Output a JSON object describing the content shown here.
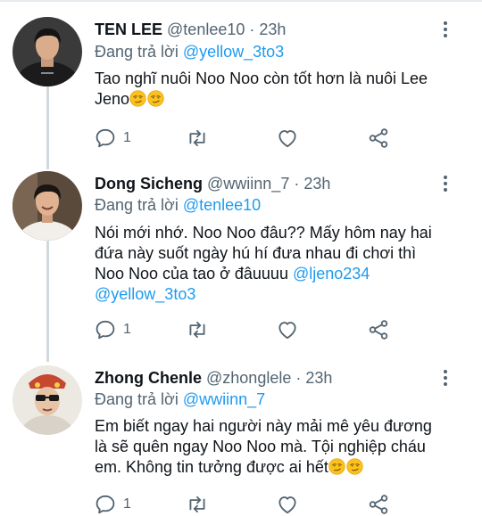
{
  "tweets": [
    {
      "name": "TEN LEE",
      "handle": "@tenlee10",
      "sep": "·",
      "time": "23h",
      "reply_prefix": "Đang trả lời",
      "reply_to": "@yellow_3to3",
      "lines": [
        [
          {
            "t": "Tao nghĩ nuôi Noo Noo còn tốt hơn là nuôi Lee"
          }
        ],
        [
          {
            "t": "Jeno"
          },
          {
            "e": "smirk-emoji"
          },
          {
            "e": "smirk-emoji"
          }
        ]
      ],
      "reply_count": "1"
    },
    {
      "name": "Dong Sicheng",
      "handle": "@wwiinn_7",
      "sep": "·",
      "time": "23h",
      "reply_prefix": "Đang trả lời",
      "reply_to": "@tenlee10",
      "lines": [
        [
          {
            "t": "Nói mới nhớ. Noo Noo đâu?? Mấy hôm nay hai"
          }
        ],
        [
          {
            "t": "đứa này suốt ngày hú hí đưa nhau đi chơi thì"
          }
        ],
        [
          {
            "t": "Noo Noo của tao ở đâuuuu "
          },
          {
            "m": "@ljeno234"
          }
        ],
        [
          {
            "m": "@yellow_3to3"
          }
        ]
      ],
      "reply_count": "1"
    },
    {
      "name": "Zhong Chenle",
      "handle": "@zhonglele",
      "sep": "·",
      "time": "23h",
      "reply_prefix": "Đang trả lời",
      "reply_to": "@wwiinn_7",
      "lines": [
        [
          {
            "t": "Em biết ngay hai người này mải mê yêu đương"
          }
        ],
        [
          {
            "t": "là sẽ quên ngay Noo Noo mà. Tội nghiệp cháu"
          }
        ],
        [
          {
            "t": "em. Không tin tưởng được ai hết"
          },
          {
            "e": "smirk-emoji"
          },
          {
            "e": "smirk-emoji"
          }
        ]
      ],
      "reply_count": "1"
    }
  ],
  "icons": {
    "reply": "reply-icon",
    "retweet": "retweet-icon",
    "like": "heart-icon",
    "share": "share-icon",
    "more": "more-vertical-icon"
  },
  "colors": {
    "text": "#0f1419",
    "secondary": "#536471",
    "link": "#1d9bf0",
    "thread": "#cfd9de"
  }
}
